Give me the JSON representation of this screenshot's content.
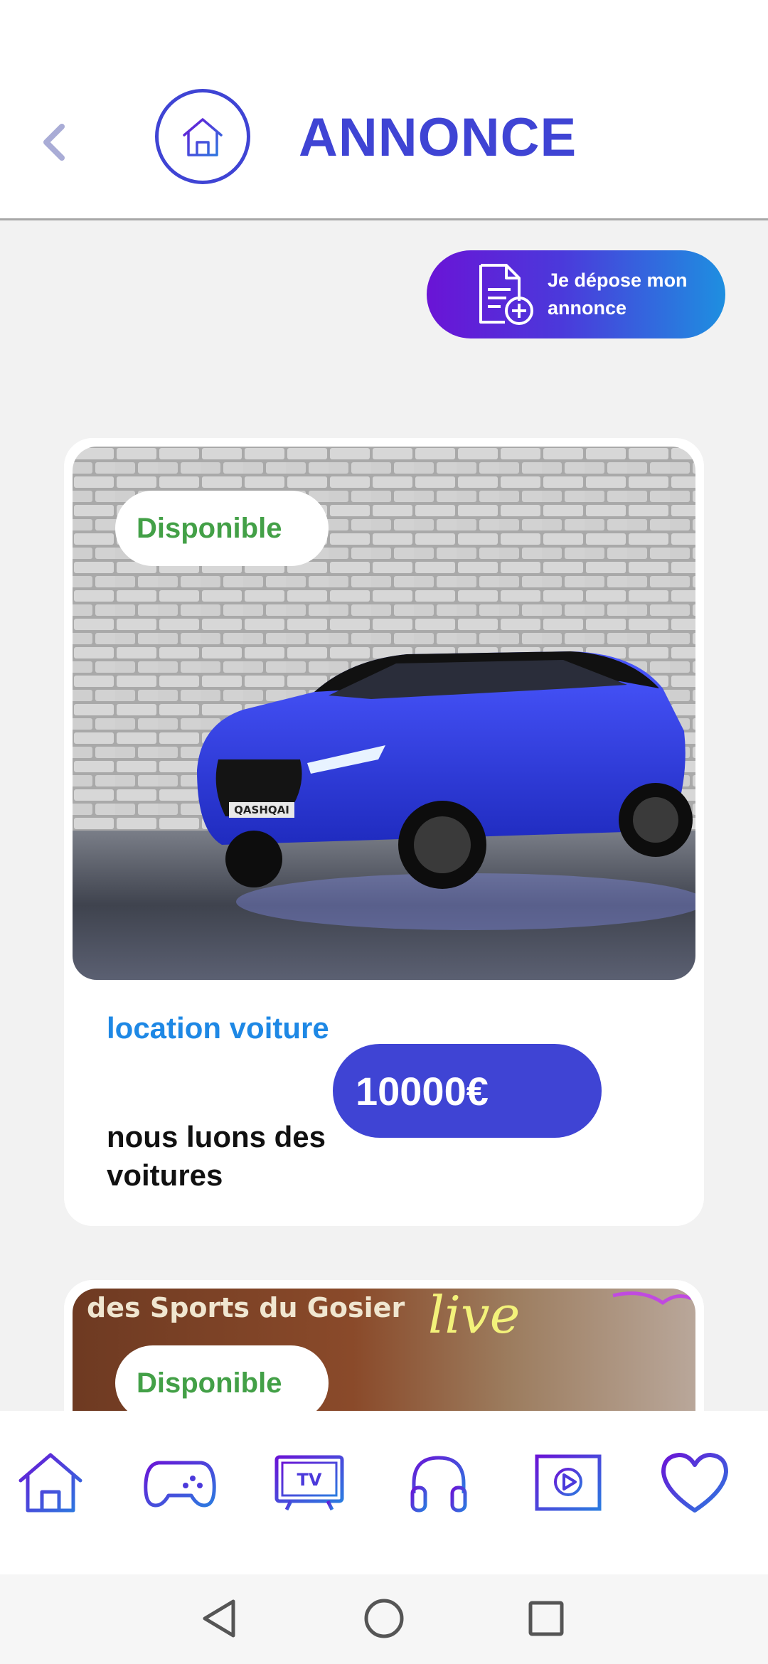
{
  "header": {
    "title": "ANNONCE",
    "back_icon": "chevron-left-icon",
    "home_icon": "home-icon"
  },
  "deposit_button": {
    "label": "Je dépose mon annonce",
    "icon": "document-add-icon"
  },
  "listings": [
    {
      "status": "Disponible",
      "title": "location voiture",
      "price": "10000€",
      "description": "nous luons des voitures",
      "photo": "blue-suv-photo",
      "photo_caption": "QASHQAI"
    },
    {
      "status": "Disponible",
      "photo": "sports-venue-photo",
      "photo_caption": "des Sports du Gosier",
      "neon_text": "live"
    }
  ],
  "bottom_nav": [
    {
      "name": "home",
      "icon": "home-icon"
    },
    {
      "name": "games",
      "icon": "gamepad-icon"
    },
    {
      "name": "tv",
      "icon": "tv-icon",
      "label": "TV"
    },
    {
      "name": "music",
      "icon": "headphones-icon"
    },
    {
      "name": "video",
      "icon": "video-play-icon"
    },
    {
      "name": "favorites",
      "icon": "heart-icon"
    }
  ],
  "system_nav": [
    "back-triangle-icon",
    "home-circle-icon",
    "recents-square-icon"
  ],
  "colors": {
    "accent": "#3f44d4",
    "title_blue": "#1e88e5",
    "available_green": "#43a047",
    "gradient_start": "#6a14d6",
    "gradient_end": "#1e8fe0",
    "background": "#f2f2f2"
  }
}
